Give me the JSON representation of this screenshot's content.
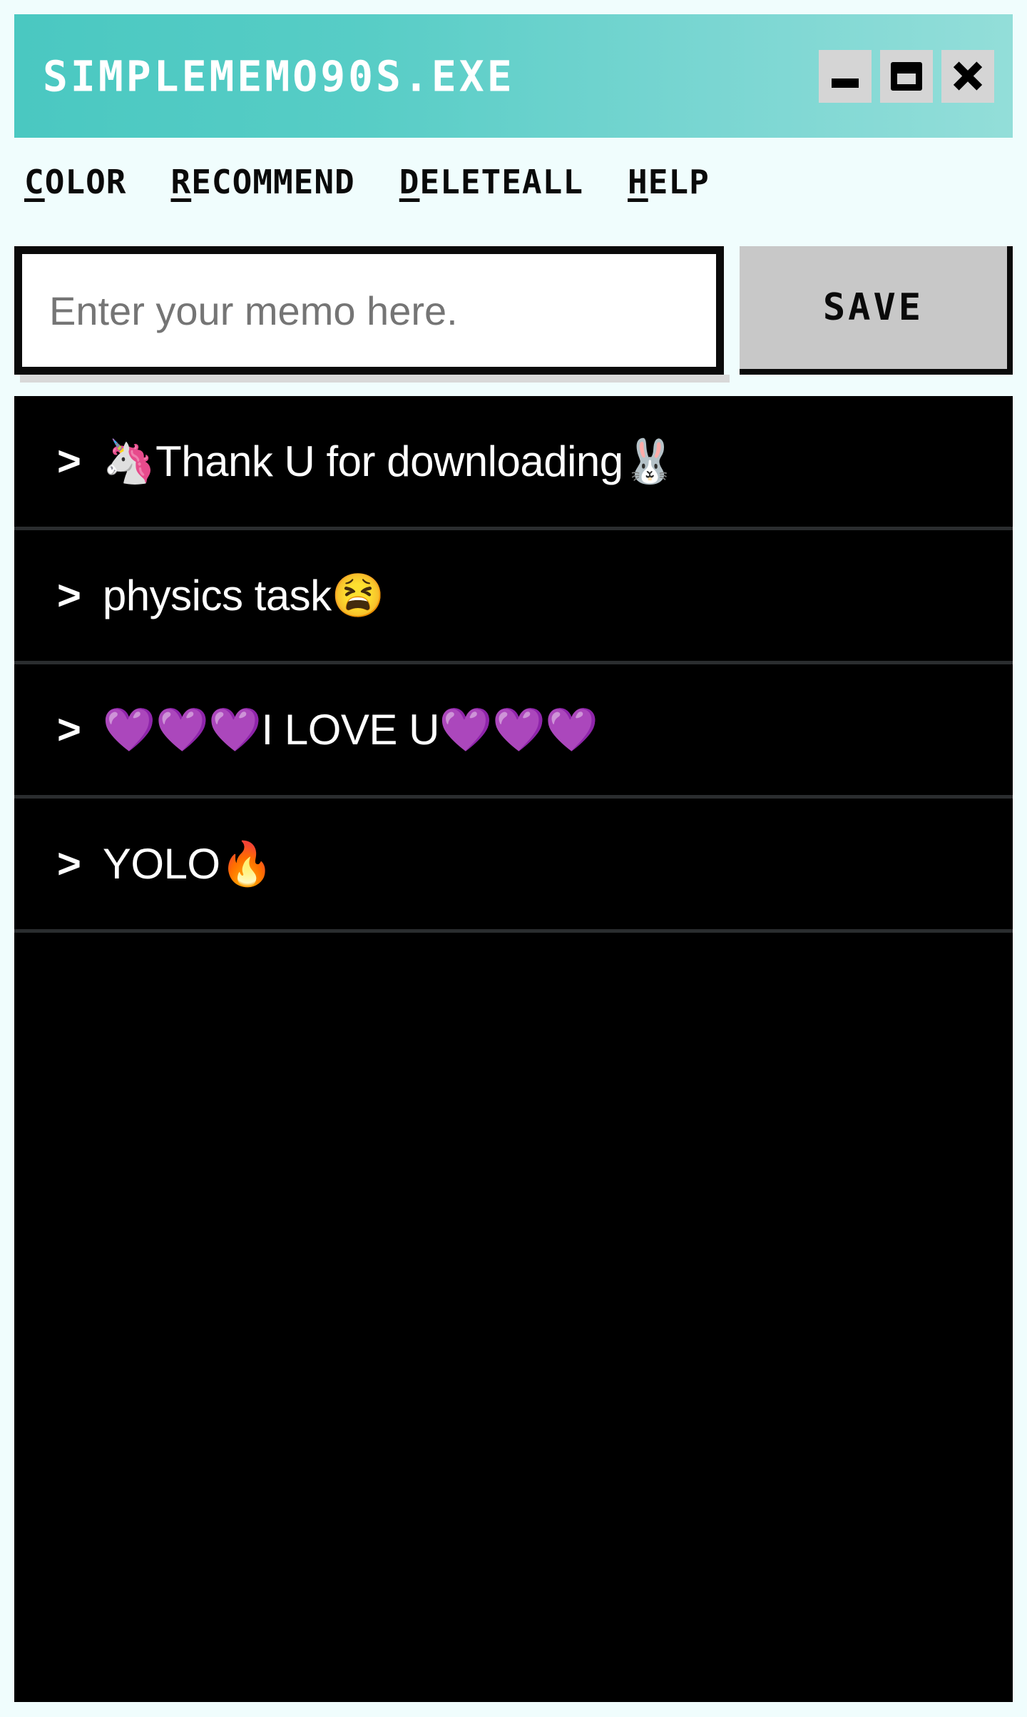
{
  "window": {
    "title": "SIMPLEMEMO90S.EXE",
    "controls": {
      "minimize": "minimize-button",
      "maximize": "maximize-button",
      "close": "close-button"
    },
    "titlebar_gradient_from": "#4ac8c1",
    "titlebar_gradient_to": "#93ded9",
    "page_background": "#f0fdfd"
  },
  "menu": {
    "items": [
      {
        "accel": "C",
        "rest": "OLOR",
        "full": "COLOR"
      },
      {
        "accel": "R",
        "rest": "ECOMMEND",
        "full": "RECOMMEND"
      },
      {
        "accel": "D",
        "rest": "ELETEALL",
        "full": "DELETEALL"
      },
      {
        "accel": "H",
        "rest": "ELP",
        "full": "HELP"
      }
    ]
  },
  "compose": {
    "input_value": "",
    "input_placeholder": "Enter your memo here.",
    "save_label": "SAVE"
  },
  "memos": {
    "caret": ">",
    "items": [
      {
        "text": "🦄Thank U for downloading🐰"
      },
      {
        "text": "physics task😫"
      },
      {
        "text": "💜💜💜I LOVE U💜💜💜"
      },
      {
        "text": "YOLO🔥"
      }
    ]
  }
}
